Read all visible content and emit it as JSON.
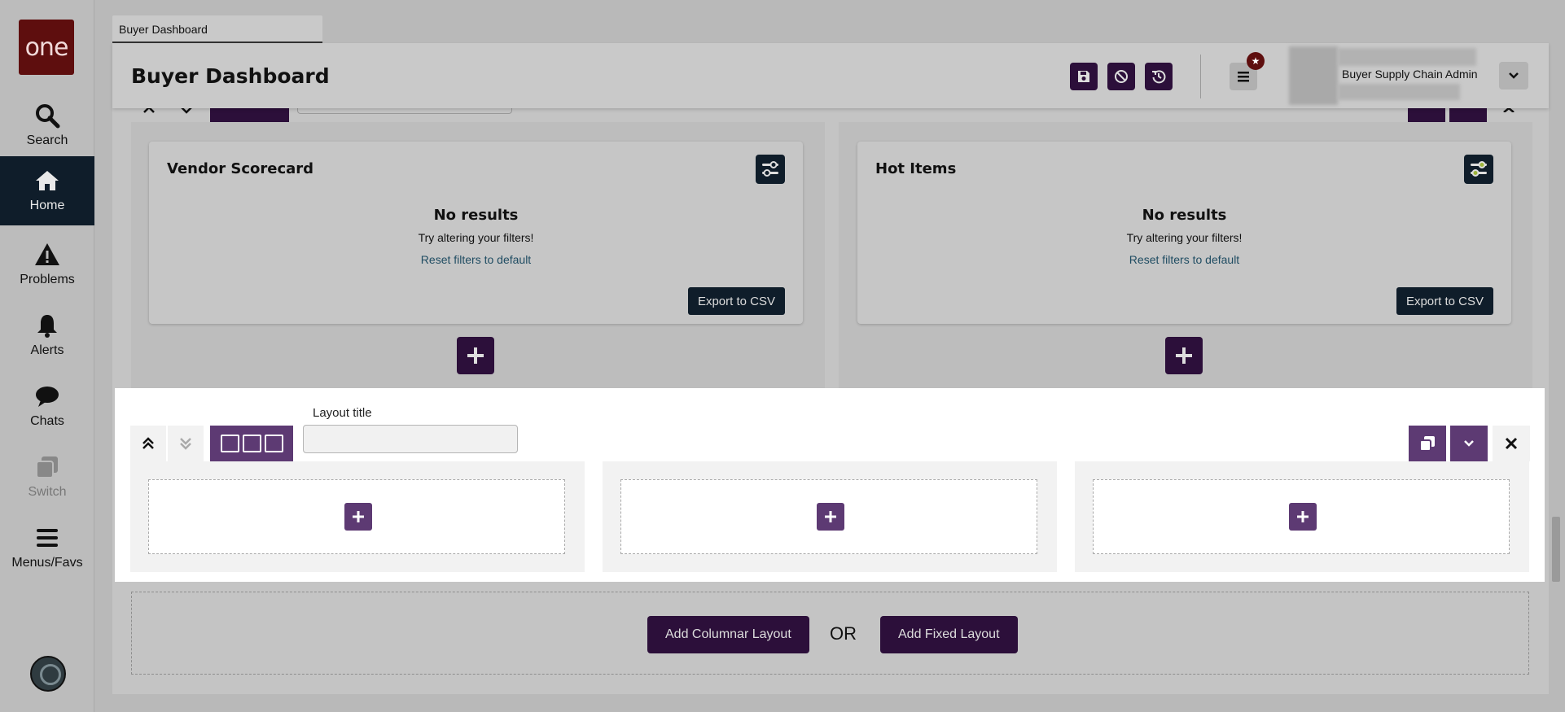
{
  "nav": {
    "logo_text": "one",
    "items": [
      {
        "label": "Search",
        "icon": "search-icon"
      },
      {
        "label": "Home",
        "icon": "home-icon",
        "active": true
      },
      {
        "label": "Problems",
        "icon": "warning-icon"
      },
      {
        "label": "Alerts",
        "icon": "bell-icon"
      },
      {
        "label": "Chats",
        "icon": "chat-icon"
      },
      {
        "label": "Switch",
        "icon": "switch-icon",
        "disabled": true
      },
      {
        "label": "Menus/Favs",
        "icon": "hamburger-icon"
      }
    ]
  },
  "tab": {
    "label": "Buyer Dashboard"
  },
  "header": {
    "title": "Buyer Dashboard",
    "user_role": "Buyer Supply Chain Admin",
    "buttons": [
      "save-icon",
      "cancel-icon",
      "history-icon"
    ]
  },
  "widgets": [
    {
      "title": "Vendor Scorecard",
      "no_results": "No results",
      "hint": "Try altering your filters!",
      "reset_link": "Reset filters to default",
      "export_label": "Export to CSV"
    },
    {
      "title": "Hot Items",
      "no_results": "No results",
      "hint": "Try altering your filters!",
      "reset_link": "Reset filters to default",
      "export_label": "Export to CSV"
    }
  ],
  "active_layout": {
    "title_label": "Layout title",
    "title_value": "",
    "columns": 3
  },
  "add_layout": {
    "columnar_label": "Add Columnar Layout",
    "or_text": "OR",
    "fixed_label": "Add Fixed Layout"
  },
  "colors": {
    "accent_purple": "#5d3a73",
    "dark_purple": "#2c0f3a",
    "navy": "#0f1d2a",
    "brand_red": "#5e0e0e"
  }
}
